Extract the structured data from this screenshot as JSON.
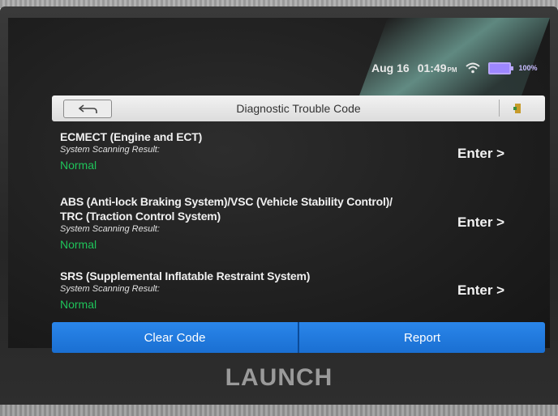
{
  "status_bar": {
    "date": "Aug 16",
    "time": "01:49",
    "time_suffix": "PM",
    "battery": "100%"
  },
  "header": {
    "title": "Diagnostic Trouble Code",
    "back_icon": "back-arrow-icon",
    "exit_icon": "exit-door-icon"
  },
  "systems": [
    {
      "name_lines": [
        "ECMECT (Engine and ECT)"
      ],
      "result_label": "System Scanning Result:",
      "status": "Normal",
      "action": "Enter >"
    },
    {
      "name_lines": [
        "ABS (Anti-lock Braking System)/VSC (Vehicle Stability Control)/",
        "TRC (Traction Control System)"
      ],
      "result_label": "System Scanning Result:",
      "status": "Normal",
      "action": "Enter >"
    },
    {
      "name_lines": [
        "SRS (Supplemental Inflatable Restraint System)"
      ],
      "result_label": "System Scanning Result:",
      "status": "Normal",
      "action": "Enter >"
    }
  ],
  "footer": {
    "clear_code_label": "Clear Code",
    "report_label": "Report"
  },
  "device": {
    "brand": "LAUNCH"
  },
  "colors": {
    "accent_blue": "#1f7ae0",
    "status_normal": "#1fc35a",
    "title_bar": "#e6e6e6"
  }
}
